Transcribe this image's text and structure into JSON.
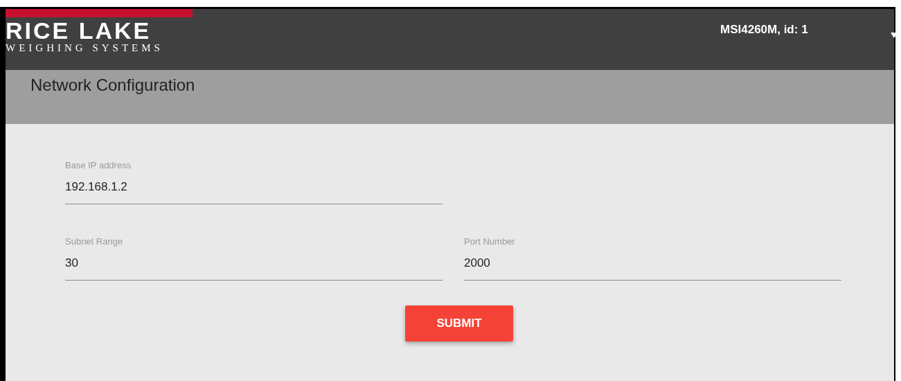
{
  "header": {
    "logo_title": "RICE LAKE",
    "logo_subtitle": "WEIGHING SYSTEMS",
    "device": "MSI4260M, id: 1"
  },
  "page_title": "Network Configuration",
  "fields": [
    {
      "label": "Base IP address",
      "value": "192.168.1.2"
    },
    {
      "label": "Subnet Range",
      "value": "30"
    },
    {
      "label": "Port Number",
      "value": "2000"
    }
  ],
  "submit": "SUBMIT"
}
